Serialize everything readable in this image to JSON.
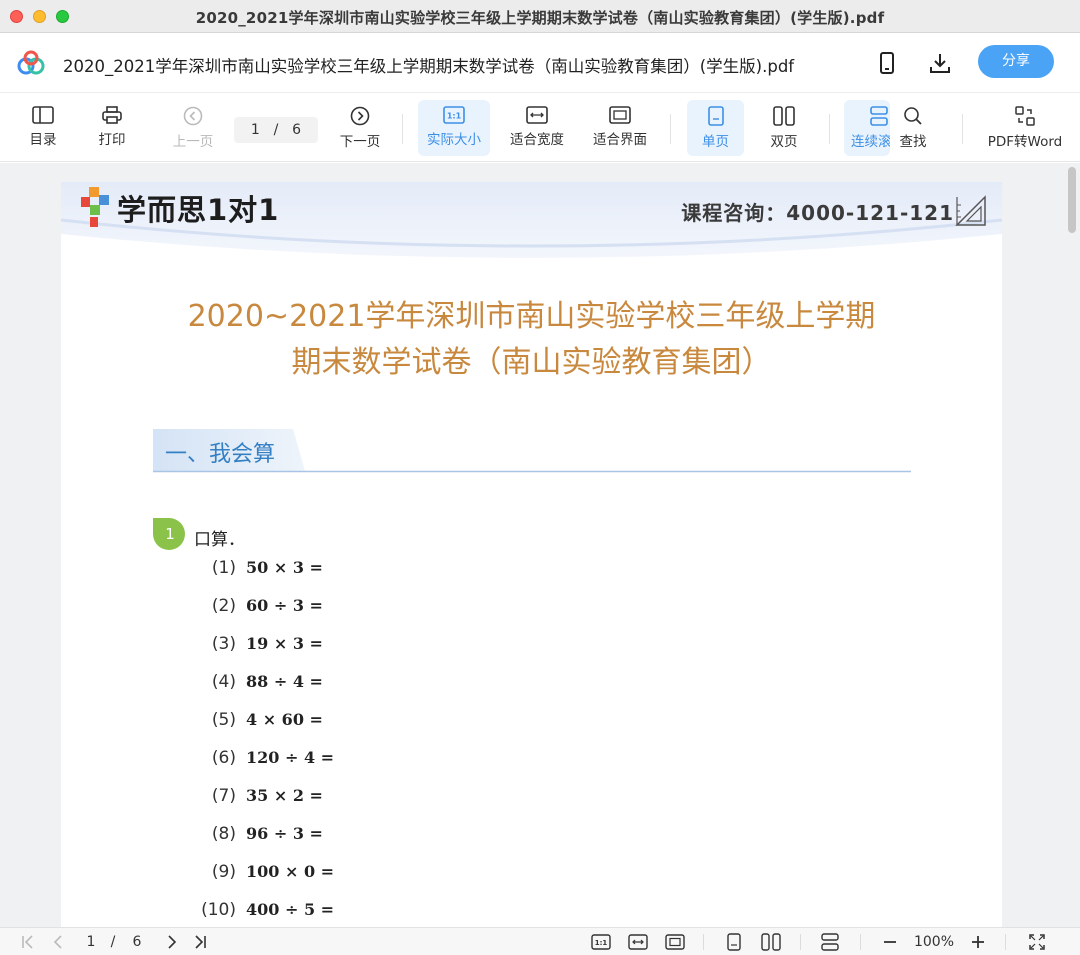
{
  "window": {
    "title": "2020_2021学年深圳市南山实验学校三年级上学期期末数学试卷（南山实验教育集团）(学生版).pdf"
  },
  "header": {
    "doc_title": "2020_2021学年深圳市南山实验学校三年级上学期期末数学试卷（南山实验教育集团）(学生版).pdf",
    "share_label": "分享",
    "icons": [
      "phone-icon",
      "download-icon"
    ]
  },
  "toolbar": {
    "toc": "目录",
    "print": "打印",
    "prev": "上一页",
    "page_current": "1",
    "page_sep": "/",
    "page_total": "6",
    "next": "下一页",
    "actual_size": "实际大小",
    "fit_width": "适合宽度",
    "fit_page": "适合界面",
    "single": "单页",
    "double": "双页",
    "continuous": "连续滚",
    "find": "查找",
    "pdf_to_word": "PDF转Word"
  },
  "document": {
    "brand": "学而思1对1",
    "hotline": "课程咨询：4000-121-121",
    "title_line1": "2020~2021学年深圳市南山实验学校三年级上学期",
    "title_line2": "期末数学试卷（南山实验教育集团）",
    "section": "一、我会算",
    "question_number": "1",
    "question_label": "口算．",
    "items": [
      {
        "num": "(1)",
        "expr": "50 × 3 ="
      },
      {
        "num": "(2)",
        "expr": "60 ÷ 3 ="
      },
      {
        "num": "(3)",
        "expr": "19 × 3 ="
      },
      {
        "num": "(4)",
        "expr": "88 ÷ 4 ="
      },
      {
        "num": "(5)",
        "expr": "4 × 60 ="
      },
      {
        "num": "(6)",
        "expr": "120 ÷ 4 ="
      },
      {
        "num": "(7)",
        "expr": "35 × 2 ="
      },
      {
        "num": "(8)",
        "expr": "96 ÷ 3 ="
      },
      {
        "num": "(9)",
        "expr": "100 × 0 ="
      },
      {
        "num": "(10)",
        "expr": "400 ÷ 5 ="
      }
    ]
  },
  "bottombar": {
    "page_current": "1",
    "page_sep": "/",
    "page_total": "6",
    "zoom": "100%"
  },
  "colors": {
    "accent": "#4aa3f5",
    "title_orange": "#c8893f",
    "section_blue": "#3580c4",
    "badge_green": "#8bc34a"
  }
}
